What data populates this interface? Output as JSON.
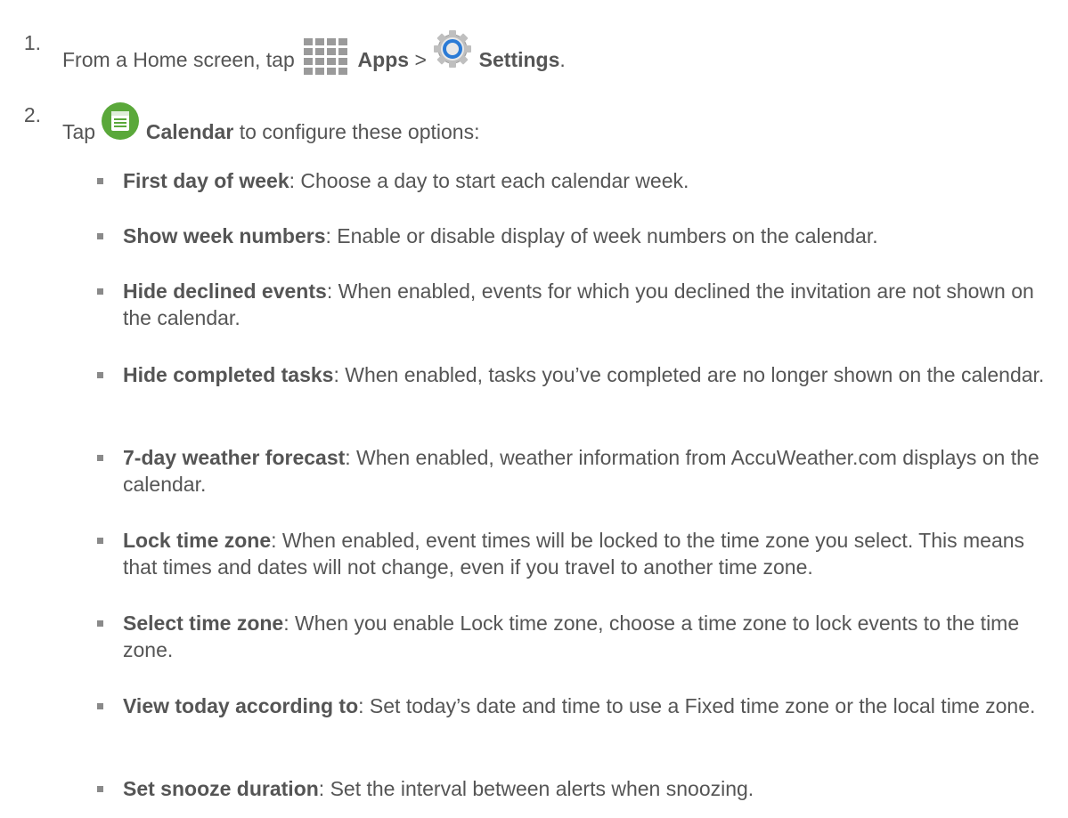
{
  "steps": [
    {
      "number": "1.",
      "text_before": "From a Home screen, tap",
      "apps_label": "Apps",
      "separator": ">",
      "settings_label": "Settings",
      "end": "."
    },
    {
      "number": "2.",
      "text_before": "Tap",
      "calendar_label": "Calendar",
      "text_after": "to configure these options:"
    }
  ],
  "icons": {
    "apps": "apps-grid-icon",
    "settings": "settings-gear-icon",
    "calendar": "calendar-app-icon"
  },
  "colors": {
    "text": "#555555",
    "bullet": "#8a8a8a",
    "calendar_green": "#5aa83a",
    "settings_blue": "#2b7bd6"
  },
  "options": [
    {
      "term": "First day of week",
      "desc": ": Choose a day to start each calendar week."
    },
    {
      "term": "Show week numbers",
      "desc": ": Enable or disable display of week numbers on the calendar."
    },
    {
      "term": "Hide declined events",
      "desc": ": When enabled, events for which you declined the invitation are not shown on the calendar."
    },
    {
      "term": "Hide completed tasks",
      "desc": ": When enabled, tasks you’ve completed are no longer shown on the calendar."
    },
    {
      "term": "7-day weather forecast",
      "desc": ": When enabled, weather information from AccuWeather.com displays on the calendar."
    },
    {
      "term": "Lock time zone",
      "desc": ": When enabled, event times will be locked to the time zone you select. This means that times and dates will not change, even if you travel to another time zone."
    },
    {
      "term": "Select time zone",
      "desc": ": When you enable Lock time zone, choose a time zone to lock events to the time zone."
    },
    {
      "term": "View today according to",
      "desc": ": Set today’s date and time to use a Fixed time zone or the local time zone."
    },
    {
      "term": "Set snooze duration",
      "desc": ": Set the interval between alerts when snoozing."
    }
  ]
}
